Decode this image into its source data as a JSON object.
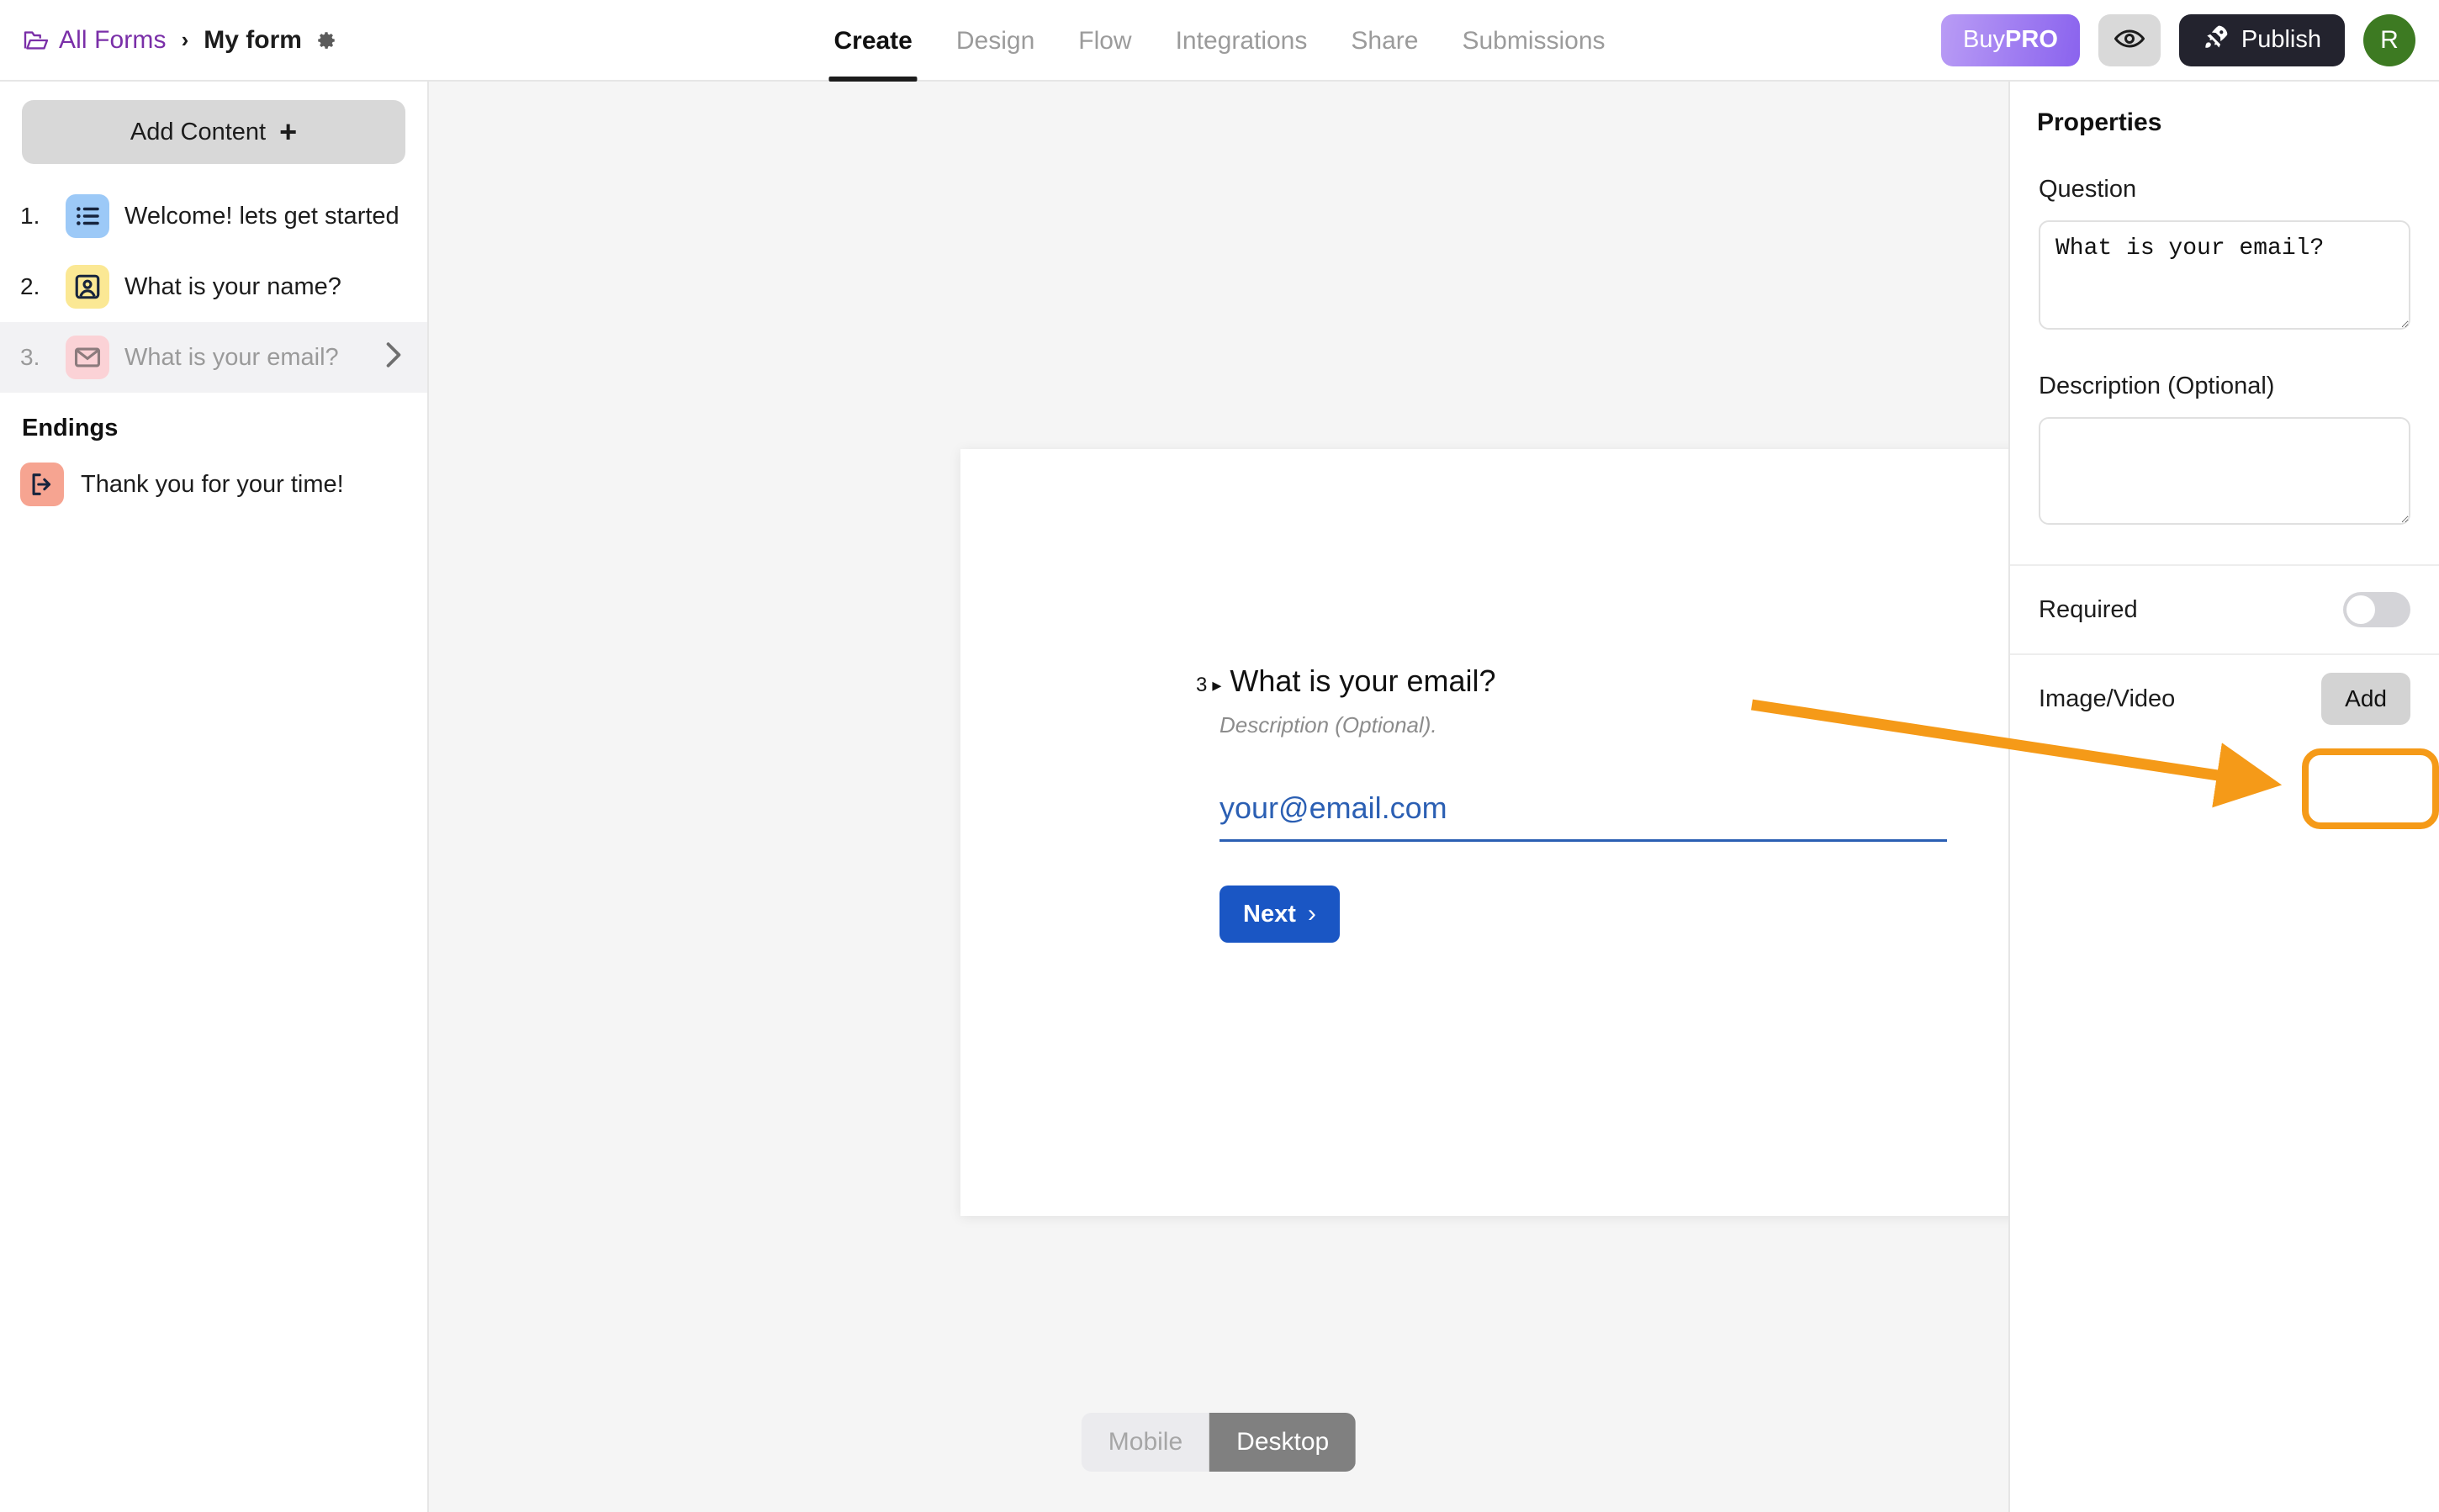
{
  "header": {
    "breadcrumb": {
      "folder_icon": "folder-open-icon",
      "root": "All Forms",
      "separator": "›",
      "current": "My form",
      "settings_icon": "gear-icon"
    },
    "tabs": [
      {
        "label": "Create",
        "active": true
      },
      {
        "label": "Design",
        "active": false
      },
      {
        "label": "Flow",
        "active": false
      },
      {
        "label": "Integrations",
        "active": false
      },
      {
        "label": "Share",
        "active": false
      },
      {
        "label": "Submissions",
        "active": false
      }
    ],
    "actions": {
      "buy_prefix": "Buy",
      "buy_suffix": "PRO",
      "preview_icon": "eye-icon",
      "publish_icon": "rocket-icon",
      "publish_label": "Publish",
      "avatar_initial": "R"
    },
    "colors": {
      "breadcrumb_link": "#7a2fa8",
      "pro_gradient_start": "#b99cf5",
      "pro_gradient_end": "#8a63ee",
      "publish_bg": "#23232e",
      "avatar_bg": "#3d7a22"
    }
  },
  "sidebar": {
    "add_content_label": "Add Content",
    "add_content_icon": "plus-icon",
    "slides": [
      {
        "number": "1.",
        "label": "Welcome! lets get started",
        "icon": "list-icon",
        "icon_bg": "#9cc9f7",
        "selected": false
      },
      {
        "number": "2.",
        "label": "What is your name?",
        "icon": "contact-portrait-icon",
        "icon_bg": "#fbe894",
        "selected": false
      },
      {
        "number": "3.",
        "label": "What is your email?",
        "icon": "envelope-icon",
        "icon_bg": "#fbd2d6",
        "selected": true,
        "chevron_icon": "chevron-right-icon"
      }
    ],
    "endings_title": "Endings",
    "endings": [
      {
        "label": "Thank you for your time!",
        "icon": "exit-arrow-icon",
        "icon_bg": "#f6a491"
      }
    ]
  },
  "canvas": {
    "question_number": "3",
    "question_caret": "▸",
    "question_text": "What is your email?",
    "description_text": "Description (Optional).",
    "email_placeholder": "your@email.com",
    "email_value": "",
    "next_label": "Next",
    "next_icon": "chevron-right-icon",
    "device_toggle": [
      {
        "label": "Mobile",
        "active": false
      },
      {
        "label": "Desktop",
        "active": true
      }
    ]
  },
  "properties": {
    "title": "Properties",
    "question_label": "Question",
    "question_value": "What is your email?",
    "question_placeholder": "",
    "description_label": "Description (Optional)",
    "description_value": "",
    "description_placeholder": "",
    "required_label": "Required",
    "required_on": false,
    "image_video_label": "Image/Video",
    "add_label": "Add"
  },
  "annotation": {
    "highlight_color": "#f59a18",
    "arrow_target": "add-button",
    "arrow_label": ""
  }
}
